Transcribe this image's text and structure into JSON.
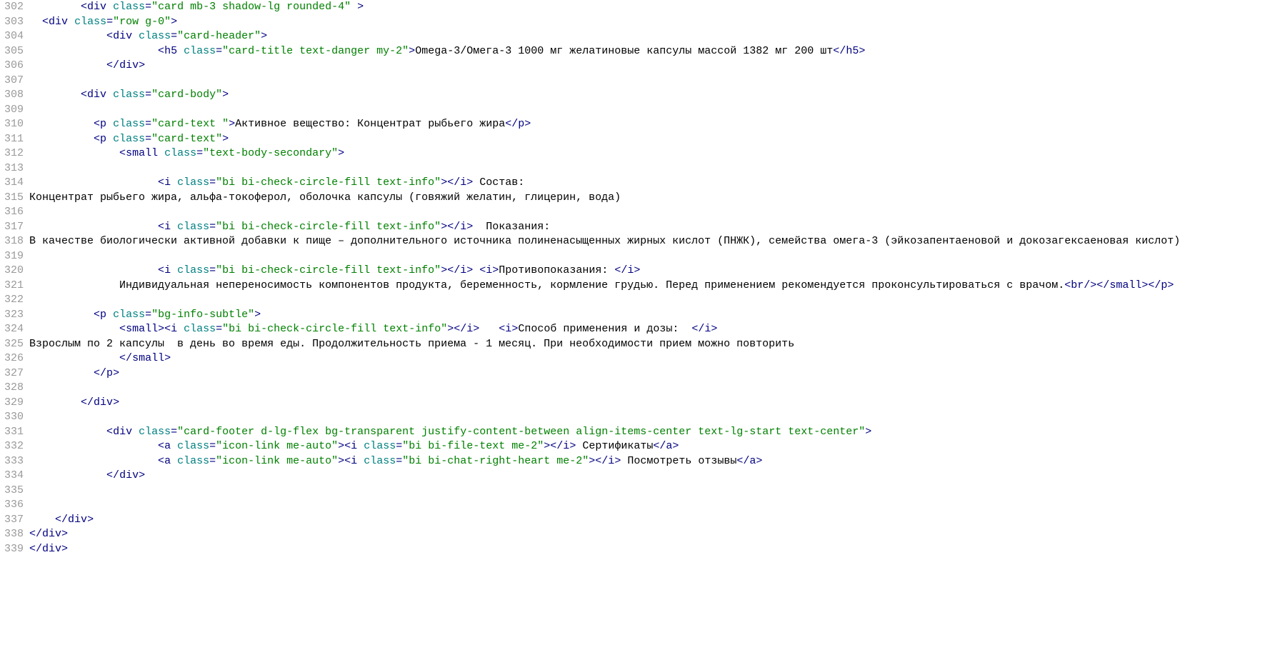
{
  "startLine": 302,
  "lines": [
    {
      "indent": "        ",
      "tokens": [
        {
          "c": "p",
          "t": "<"
        },
        {
          "c": "t",
          "t": "div"
        },
        {
          "c": "x",
          "t": " "
        },
        {
          "c": "a",
          "t": "class"
        },
        {
          "c": "p",
          "t": "="
        },
        {
          "c": "s",
          "t": "\"card mb-3 shadow-lg rounded-4\""
        },
        {
          "c": "x",
          "t": " "
        },
        {
          "c": "p",
          "t": ">"
        }
      ]
    },
    {
      "indent": "  ",
      "tokens": [
        {
          "c": "p",
          "t": "<"
        },
        {
          "c": "t",
          "t": "div"
        },
        {
          "c": "x",
          "t": " "
        },
        {
          "c": "a",
          "t": "class"
        },
        {
          "c": "p",
          "t": "="
        },
        {
          "c": "s",
          "t": "\"row g-0\""
        },
        {
          "c": "p",
          "t": ">"
        }
      ]
    },
    {
      "indent": "            ",
      "tokens": [
        {
          "c": "p",
          "t": "<"
        },
        {
          "c": "t",
          "t": "div"
        },
        {
          "c": "x",
          "t": " "
        },
        {
          "c": "a",
          "t": "class"
        },
        {
          "c": "p",
          "t": "="
        },
        {
          "c": "s",
          "t": "\"card-header\""
        },
        {
          "c": "p",
          "t": ">"
        }
      ]
    },
    {
      "indent": "                    ",
      "tokens": [
        {
          "c": "p",
          "t": "<"
        },
        {
          "c": "t",
          "t": "h5"
        },
        {
          "c": "x",
          "t": " "
        },
        {
          "c": "a",
          "t": "class"
        },
        {
          "c": "p",
          "t": "="
        },
        {
          "c": "s",
          "t": "\"card-title text-danger my-2\""
        },
        {
          "c": "p",
          "t": ">"
        },
        {
          "c": "x",
          "t": "Omega-3/Омега-3 1000 мг желатиновые капсулы массой 1382 мг 200 шт"
        },
        {
          "c": "p",
          "t": "</"
        },
        {
          "c": "t",
          "t": "h5"
        },
        {
          "c": "p",
          "t": ">"
        }
      ]
    },
    {
      "indent": "            ",
      "tokens": [
        {
          "c": "p",
          "t": "</"
        },
        {
          "c": "t",
          "t": "div"
        },
        {
          "c": "p",
          "t": ">"
        }
      ]
    },
    {
      "indent": "",
      "tokens": []
    },
    {
      "indent": "        ",
      "tokens": [
        {
          "c": "p",
          "t": "<"
        },
        {
          "c": "t",
          "t": "div"
        },
        {
          "c": "x",
          "t": " "
        },
        {
          "c": "a",
          "t": "class"
        },
        {
          "c": "p",
          "t": "="
        },
        {
          "c": "s",
          "t": "\"card-body\""
        },
        {
          "c": "p",
          "t": ">"
        }
      ]
    },
    {
      "indent": "",
      "tokens": []
    },
    {
      "indent": "          ",
      "tokens": [
        {
          "c": "p",
          "t": "<"
        },
        {
          "c": "t",
          "t": "p"
        },
        {
          "c": "x",
          "t": " "
        },
        {
          "c": "a",
          "t": "class"
        },
        {
          "c": "p",
          "t": "="
        },
        {
          "c": "s",
          "t": "\"card-text \""
        },
        {
          "c": "p",
          "t": ">"
        },
        {
          "c": "x",
          "t": "Активное вещество: Концентрат рыбьего жира"
        },
        {
          "c": "p",
          "t": "</"
        },
        {
          "c": "t",
          "t": "p"
        },
        {
          "c": "p",
          "t": ">"
        }
      ]
    },
    {
      "indent": "          ",
      "tokens": [
        {
          "c": "p",
          "t": "<"
        },
        {
          "c": "t",
          "t": "p"
        },
        {
          "c": "x",
          "t": " "
        },
        {
          "c": "a",
          "t": "class"
        },
        {
          "c": "p",
          "t": "="
        },
        {
          "c": "s",
          "t": "\"card-text\""
        },
        {
          "c": "p",
          "t": ">"
        }
      ]
    },
    {
      "indent": "              ",
      "tokens": [
        {
          "c": "p",
          "t": "<"
        },
        {
          "c": "t",
          "t": "small"
        },
        {
          "c": "x",
          "t": " "
        },
        {
          "c": "a",
          "t": "class"
        },
        {
          "c": "p",
          "t": "="
        },
        {
          "c": "s",
          "t": "\"text-body-secondary\""
        },
        {
          "c": "p",
          "t": ">"
        }
      ]
    },
    {
      "indent": "",
      "tokens": []
    },
    {
      "indent": "                    ",
      "tokens": [
        {
          "c": "p",
          "t": "<"
        },
        {
          "c": "t",
          "t": "i"
        },
        {
          "c": "x",
          "t": " "
        },
        {
          "c": "a",
          "t": "class"
        },
        {
          "c": "p",
          "t": "="
        },
        {
          "c": "s",
          "t": "\"bi bi-check-circle-fill text-info\""
        },
        {
          "c": "p",
          "t": "></"
        },
        {
          "c": "t",
          "t": "i"
        },
        {
          "c": "p",
          "t": ">"
        },
        {
          "c": "x",
          "t": " Состав:"
        }
      ]
    },
    {
      "indent": "",
      "tokens": [
        {
          "c": "x",
          "t": "Концентрат рыбьего жира, альфа-токоферол, оболочка капсулы (говяжий желатин, глицерин, вода)"
        }
      ]
    },
    {
      "indent": "",
      "tokens": []
    },
    {
      "indent": "                    ",
      "tokens": [
        {
          "c": "p",
          "t": "<"
        },
        {
          "c": "t",
          "t": "i"
        },
        {
          "c": "x",
          "t": " "
        },
        {
          "c": "a",
          "t": "class"
        },
        {
          "c": "p",
          "t": "="
        },
        {
          "c": "s",
          "t": "\"bi bi-check-circle-fill text-info\""
        },
        {
          "c": "p",
          "t": "></"
        },
        {
          "c": "t",
          "t": "i"
        },
        {
          "c": "p",
          "t": ">"
        },
        {
          "c": "x",
          "t": "  Показания:"
        }
      ]
    },
    {
      "indent": "",
      "tokens": [
        {
          "c": "x",
          "t": "В качестве биологически активной добавки к пище – дополнительного источника полиненасыщенных жирных кислот (ПНЖК), семейства омега-3 (эйкозапентаеновой и докозагексаеновая кислот)"
        }
      ]
    },
    {
      "indent": "",
      "tokens": []
    },
    {
      "indent": "                    ",
      "tokens": [
        {
          "c": "p",
          "t": "<"
        },
        {
          "c": "t",
          "t": "i"
        },
        {
          "c": "x",
          "t": " "
        },
        {
          "c": "a",
          "t": "class"
        },
        {
          "c": "p",
          "t": "="
        },
        {
          "c": "s",
          "t": "\"bi bi-check-circle-fill text-info\""
        },
        {
          "c": "p",
          "t": "></"
        },
        {
          "c": "t",
          "t": "i"
        },
        {
          "c": "p",
          "t": ">"
        },
        {
          "c": "x",
          "t": " "
        },
        {
          "c": "p",
          "t": "<"
        },
        {
          "c": "t",
          "t": "i"
        },
        {
          "c": "p",
          "t": ">"
        },
        {
          "c": "x",
          "t": "Противопоказания: "
        },
        {
          "c": "p",
          "t": "</"
        },
        {
          "c": "t",
          "t": "i"
        },
        {
          "c": "p",
          "t": ">"
        }
      ]
    },
    {
      "indent": "              ",
      "tokens": [
        {
          "c": "x",
          "t": "Индивидуальная непереносимость компонентов продукта, беременность, кормление грудью. Перед применением рекомендуется проконсультироваться с врачом."
        },
        {
          "c": "p",
          "t": "<"
        },
        {
          "c": "t",
          "t": "br"
        },
        {
          "c": "p",
          "t": "/></"
        },
        {
          "c": "t",
          "t": "small"
        },
        {
          "c": "p",
          "t": "></"
        },
        {
          "c": "t",
          "t": "p"
        },
        {
          "c": "p",
          "t": ">"
        }
      ]
    },
    {
      "indent": "",
      "tokens": []
    },
    {
      "indent": "          ",
      "tokens": [
        {
          "c": "p",
          "t": "<"
        },
        {
          "c": "t",
          "t": "p"
        },
        {
          "c": "x",
          "t": " "
        },
        {
          "c": "a",
          "t": "class"
        },
        {
          "c": "p",
          "t": "="
        },
        {
          "c": "s",
          "t": "\"bg-info-subtle\""
        },
        {
          "c": "p",
          "t": ">"
        }
      ]
    },
    {
      "indent": "              ",
      "tokens": [
        {
          "c": "p",
          "t": "<"
        },
        {
          "c": "t",
          "t": "small"
        },
        {
          "c": "p",
          "t": "><"
        },
        {
          "c": "t",
          "t": "i"
        },
        {
          "c": "x",
          "t": " "
        },
        {
          "c": "a",
          "t": "class"
        },
        {
          "c": "p",
          "t": "="
        },
        {
          "c": "s",
          "t": "\"bi bi-check-circle-fill text-info\""
        },
        {
          "c": "p",
          "t": "></"
        },
        {
          "c": "t",
          "t": "i"
        },
        {
          "c": "p",
          "t": ">"
        },
        {
          "c": "x",
          "t": "   "
        },
        {
          "c": "p",
          "t": "<"
        },
        {
          "c": "t",
          "t": "i"
        },
        {
          "c": "p",
          "t": ">"
        },
        {
          "c": "x",
          "t": "Способ применения и дозы:  "
        },
        {
          "c": "p",
          "t": "</"
        },
        {
          "c": "t",
          "t": "i"
        },
        {
          "c": "p",
          "t": ">"
        }
      ]
    },
    {
      "indent": "",
      "tokens": [
        {
          "c": "x",
          "t": "Взрослым по 2 капсулы  в день во время еды. Продолжительность приема - 1 месяц. При необходимости прием можно повторить"
        }
      ]
    },
    {
      "indent": "              ",
      "tokens": [
        {
          "c": "p",
          "t": "</"
        },
        {
          "c": "t",
          "t": "small"
        },
        {
          "c": "p",
          "t": ">"
        }
      ]
    },
    {
      "indent": "          ",
      "tokens": [
        {
          "c": "p",
          "t": "</"
        },
        {
          "c": "t",
          "t": "p"
        },
        {
          "c": "p",
          "t": ">"
        }
      ]
    },
    {
      "indent": "",
      "tokens": []
    },
    {
      "indent": "        ",
      "tokens": [
        {
          "c": "p",
          "t": "</"
        },
        {
          "c": "t",
          "t": "div"
        },
        {
          "c": "p",
          "t": ">"
        }
      ]
    },
    {
      "indent": "",
      "tokens": []
    },
    {
      "indent": "            ",
      "tokens": [
        {
          "c": "p",
          "t": "<"
        },
        {
          "c": "t",
          "t": "div"
        },
        {
          "c": "x",
          "t": " "
        },
        {
          "c": "a",
          "t": "class"
        },
        {
          "c": "p",
          "t": "="
        },
        {
          "c": "s",
          "t": "\"card-footer d-lg-flex bg-transparent justify-content-between align-items-center text-lg-start text-center\""
        },
        {
          "c": "p",
          "t": ">"
        }
      ]
    },
    {
      "indent": "                    ",
      "tokens": [
        {
          "c": "p",
          "t": "<"
        },
        {
          "c": "t",
          "t": "a"
        },
        {
          "c": "x",
          "t": " "
        },
        {
          "c": "a",
          "t": "class"
        },
        {
          "c": "p",
          "t": "="
        },
        {
          "c": "s",
          "t": "\"icon-link me-auto\""
        },
        {
          "c": "p",
          "t": "><"
        },
        {
          "c": "t",
          "t": "i"
        },
        {
          "c": "x",
          "t": " "
        },
        {
          "c": "a",
          "t": "class"
        },
        {
          "c": "p",
          "t": "="
        },
        {
          "c": "s",
          "t": "\"bi bi-file-text me-2\""
        },
        {
          "c": "p",
          "t": "></"
        },
        {
          "c": "t",
          "t": "i"
        },
        {
          "c": "p",
          "t": ">"
        },
        {
          "c": "x",
          "t": " Сертификаты"
        },
        {
          "c": "p",
          "t": "</"
        },
        {
          "c": "t",
          "t": "a"
        },
        {
          "c": "p",
          "t": ">"
        }
      ]
    },
    {
      "indent": "                    ",
      "tokens": [
        {
          "c": "p",
          "t": "<"
        },
        {
          "c": "t",
          "t": "a"
        },
        {
          "c": "x",
          "t": " "
        },
        {
          "c": "a",
          "t": "class"
        },
        {
          "c": "p",
          "t": "="
        },
        {
          "c": "s",
          "t": "\"icon-link me-auto\""
        },
        {
          "c": "p",
          "t": "><"
        },
        {
          "c": "t",
          "t": "i"
        },
        {
          "c": "x",
          "t": " "
        },
        {
          "c": "a",
          "t": "class"
        },
        {
          "c": "p",
          "t": "="
        },
        {
          "c": "s",
          "t": "\"bi bi-chat-right-heart me-2\""
        },
        {
          "c": "p",
          "t": "></"
        },
        {
          "c": "t",
          "t": "i"
        },
        {
          "c": "p",
          "t": ">"
        },
        {
          "c": "x",
          "t": " Посмотреть отзывы"
        },
        {
          "c": "p",
          "t": "</"
        },
        {
          "c": "t",
          "t": "a"
        },
        {
          "c": "p",
          "t": ">"
        }
      ]
    },
    {
      "indent": "            ",
      "tokens": [
        {
          "c": "p",
          "t": "</"
        },
        {
          "c": "t",
          "t": "div"
        },
        {
          "c": "p",
          "t": ">"
        }
      ]
    },
    {
      "indent": "",
      "tokens": []
    },
    {
      "indent": "",
      "tokens": []
    },
    {
      "indent": "    ",
      "tokens": [
        {
          "c": "p",
          "t": "</"
        },
        {
          "c": "t",
          "t": "div"
        },
        {
          "c": "p",
          "t": ">"
        }
      ]
    },
    {
      "indent": "",
      "tokens": [
        {
          "c": "p",
          "t": "</"
        },
        {
          "c": "t",
          "t": "div"
        },
        {
          "c": "p",
          "t": ">"
        }
      ]
    },
    {
      "indent": "",
      "tokens": [
        {
          "c": "p",
          "t": "</"
        },
        {
          "c": "t",
          "t": "div"
        },
        {
          "c": "p",
          "t": ">"
        }
      ]
    }
  ]
}
